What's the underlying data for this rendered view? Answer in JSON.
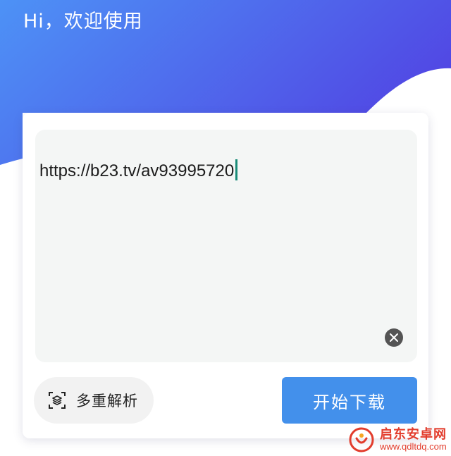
{
  "header": {
    "greeting": "Hi，欢迎使用"
  },
  "url_input": {
    "value": "https://b23.tv/av93995720"
  },
  "actions": {
    "multi_parse_label": "多重解析",
    "start_download_label": "开始下载"
  },
  "watermark": {
    "name": "启东安卓网",
    "url": "www.qdltdq.com"
  },
  "icons": {
    "clear": "clear-icon",
    "multi_parse": "scan-layers-icon",
    "watermark_logo": "watermark-logo-icon"
  },
  "colors": {
    "gradient_start": "#4d92f6",
    "gradient_end": "#5148e4",
    "primary_button": "#4390eb",
    "caret": "#1a8c78",
    "watermark": "#e23c2c"
  }
}
